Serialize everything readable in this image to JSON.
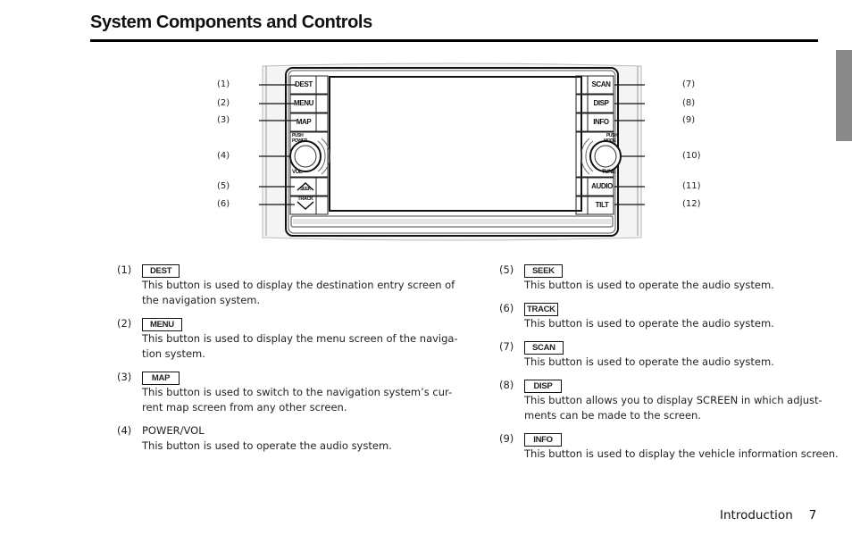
{
  "page": {
    "title": "System Components and Controls",
    "footer": {
      "section": "Introduction",
      "page_number": "7"
    }
  },
  "diagram": {
    "left_buttons": [
      "DEST",
      "MENU",
      "MAP",
      "",
      "SEEK",
      "TRACK"
    ],
    "right_buttons": [
      "SCAN",
      "DISP",
      "INFO",
      "",
      "AUDIO",
      "TILT"
    ],
    "left_knob": {
      "top_label": "PUSH",
      "sub_label": "POWER",
      "bottom_label": "VOL"
    },
    "right_knob": {
      "top_label": "PUSH",
      "sub_label": "MODE",
      "bottom_label": "TUNE"
    },
    "callouts_left": [
      "(1)",
      "(2)",
      "(3)",
      "(4)",
      "(5)",
      "(6)"
    ],
    "callouts_right": [
      "(7)",
      "(8)",
      "(9)",
      "(10)",
      "(11)",
      "(12)"
    ]
  },
  "items": [
    {
      "num": "(1)",
      "label": "DEST",
      "boxed": true,
      "lines": [
        "This button is used to display the destination entry screen of",
        "the navigation system."
      ]
    },
    {
      "num": "(2)",
      "label": "MENU",
      "boxed": true,
      "lines": [
        "This button is used to display the menu screen of the naviga-",
        "tion system."
      ]
    },
    {
      "num": "(3)",
      "label": "MAP",
      "boxed": true,
      "lines": [
        "This button is used to switch to the navigation system’s cur-",
        "rent map screen from any other screen."
      ]
    },
    {
      "num": "(4)",
      "label": "POWER/VOL",
      "boxed": false,
      "lines": [
        "This button is used to operate the audio system."
      ]
    },
    {
      "num": "(5)",
      "label": "SEEK",
      "boxed": true,
      "lines": [
        "This button is used to operate the audio system."
      ]
    },
    {
      "num": "(6)",
      "label": "TRACK",
      "boxed": true,
      "lines": [
        "This button is used to operate the audio system."
      ]
    },
    {
      "num": "(7)",
      "label": "SCAN",
      "boxed": true,
      "lines": [
        "This button is used to operate the audio system."
      ]
    },
    {
      "num": "(8)",
      "label": "DISP",
      "boxed": true,
      "lines": [
        "This button allows you to display SCREEN in which adjust-",
        "ments can be made to the screen."
      ]
    },
    {
      "num": "(9)",
      "label": "INFO",
      "boxed": true,
      "lines": [
        "This button is used to display the vehicle information screen."
      ]
    }
  ]
}
